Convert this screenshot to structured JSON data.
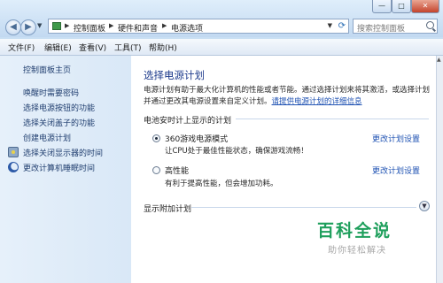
{
  "window": {
    "buttons": {
      "minimize": "—",
      "maximize": "□",
      "close": "✕"
    }
  },
  "address": {
    "back_glyph": "◀",
    "forward_glyph": "▶",
    "breadcrumb": [
      "控制面板",
      "硬件和声音",
      "电源选项"
    ],
    "separator": "▶",
    "search_placeholder": "搜索控制面板"
  },
  "menu": [
    "文件(F)",
    "编辑(E)",
    "查看(V)",
    "工具(T)",
    "帮助(H)"
  ],
  "sidebar": {
    "home": "控制面板主页",
    "items": [
      {
        "label": "唤醒时需要密码",
        "icon": ""
      },
      {
        "label": "选择电源按钮的功能",
        "icon": ""
      },
      {
        "label": "选择关闭盖子的功能",
        "icon": ""
      },
      {
        "label": "创建电源计划",
        "icon": ""
      },
      {
        "label": "选择关闭显示器的时间",
        "icon": "monitor-icon"
      },
      {
        "label": "更改计算机睡眠时间",
        "icon": "moon-icon"
      }
    ]
  },
  "main": {
    "title": "选择电源计划",
    "description": "电源计划有助于最大化计算机的性能或者节能。通过选择计划来将其激活，或选择计划并通过更改其电源设置来自定义计划。",
    "description_link": "请提供电源计划的详细信息",
    "section_label": "电池安时计上显示的计划",
    "plans": [
      {
        "name": "360游戏电源模式",
        "desc": "让CPU处于最佳性能状态，确保游戏流畅！",
        "link": "更改计划设置",
        "selected": true
      },
      {
        "name": "高性能",
        "desc": "有利于提高性能，但会增加功耗。",
        "link": "更改计划设置",
        "selected": false
      }
    ],
    "expander": "显示附加计划"
  },
  "watermark": {
    "logo": "百科全说",
    "sub": "助你轻松解决"
  },
  "colors": {
    "accent": "#1e3b8c",
    "link": "#2053b3",
    "watermark": "#1e9f5c"
  }
}
